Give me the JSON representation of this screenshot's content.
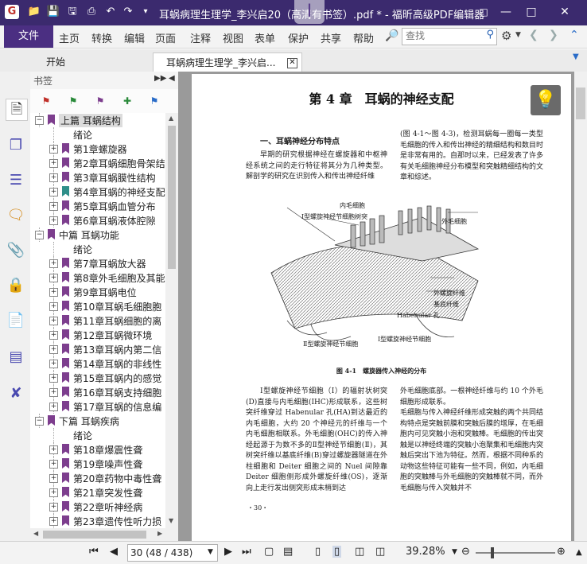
{
  "window": {
    "title": "耳蜗病理生理学_李兴启20（高清有书签）.pdf * - 福昕高级PDF编辑器"
  },
  "menu": {
    "file": "文件",
    "items": [
      "主页",
      "转换",
      "编辑",
      "页面",
      "注释",
      "视图",
      "表单",
      "保护",
      "共享",
      "帮助"
    ]
  },
  "search": {
    "placeholder": "查找"
  },
  "tabs": [
    {
      "label": "开始"
    },
    {
      "label": "耳蜗病理生理学_李兴启..."
    }
  ],
  "bookmarks": {
    "header": "书签",
    "items": [
      {
        "label": "上篇 耳蜗结构",
        "level": 0,
        "expander": "−",
        "flag": true
      },
      {
        "label": "绪论",
        "level": 1,
        "expander": "",
        "flag": false
      },
      {
        "label": "第1章螺旋器",
        "level": 1,
        "expander": "+",
        "flag": true
      },
      {
        "label": "第2章耳蜗细胞骨架结",
        "level": 1,
        "expander": "+",
        "flag": true
      },
      {
        "label": "第3章耳蜗膜性结构",
        "level": 1,
        "expander": "+",
        "flag": true
      },
      {
        "label": "第4章耳蜗的神经支配",
        "level": 1,
        "expander": "+",
        "flag": true,
        "active": true
      },
      {
        "label": "第5章耳蜗血管分布",
        "level": 1,
        "expander": "+",
        "flag": true
      },
      {
        "label": "第6章耳蜗液体腔隙",
        "level": 1,
        "expander": "+",
        "flag": true
      },
      {
        "label": "中篇 耳蜗功能",
        "level": 0,
        "expander": "−",
        "flag": true
      },
      {
        "label": "绪论",
        "level": 1,
        "expander": "",
        "flag": false
      },
      {
        "label": "第7章耳蜗放大器",
        "level": 1,
        "expander": "+",
        "flag": true
      },
      {
        "label": "第8章外毛细胞及其能",
        "level": 1,
        "expander": "+",
        "flag": true
      },
      {
        "label": "第9章耳蜗电位",
        "level": 1,
        "expander": "+",
        "flag": true
      },
      {
        "label": "第10章耳蜗毛细胞胞",
        "level": 1,
        "expander": "+",
        "flag": true
      },
      {
        "label": "第11章耳蜗细胞的离",
        "level": 1,
        "expander": "+",
        "flag": true
      },
      {
        "label": "第12章耳蜗微环境",
        "level": 1,
        "expander": "+",
        "flag": true
      },
      {
        "label": "第13章耳蜗内第二信",
        "level": 1,
        "expander": "+",
        "flag": true
      },
      {
        "label": "第14章耳蜗的非线性",
        "level": 1,
        "expander": "+",
        "flag": true
      },
      {
        "label": "第15章耳蜗内的感觉",
        "level": 1,
        "expander": "+",
        "flag": true
      },
      {
        "label": "第16章耳蜗支持细胞",
        "level": 1,
        "expander": "+",
        "flag": true
      },
      {
        "label": "第17章耳蜗的信息编",
        "level": 1,
        "expander": "+",
        "flag": true
      },
      {
        "label": "下篇 耳蜗疾病",
        "level": 0,
        "expander": "−",
        "flag": true
      },
      {
        "label": "绪论",
        "level": 1,
        "expander": "",
        "flag": false
      },
      {
        "label": "第18章爆震性聋",
        "level": 1,
        "expander": "+",
        "flag": true
      },
      {
        "label": "第19章噪声性聋",
        "level": 1,
        "expander": "+",
        "flag": true
      },
      {
        "label": "第20章药物中毒性聋",
        "level": 1,
        "expander": "+",
        "flag": true
      },
      {
        "label": "第21章突发性聋",
        "level": 1,
        "expander": "+",
        "flag": true
      },
      {
        "label": "第22章听神经病",
        "level": 1,
        "expander": "+",
        "flag": true
      },
      {
        "label": "第23章遗传性听力损",
        "level": 1,
        "expander": "+",
        "flag": true
      }
    ]
  },
  "page": {
    "chapter_title": "第 4 章　耳蜗的神经支配",
    "section_title": "一、耳蜗神经分布特点",
    "para_left_1": "早期的研究根据神经在螺旋器和中枢神经系统之间的走行特征将其分为几种类型。解剖学的研究在识别传入和传出神经纤维",
    "para_right_1": "(图 4-1～图 4-3)，检测耳蜗每一圈每一类型毛细胞的传入和传出神经的精细结构和数目时是非常有用的。自那时以来，已经发表了许多有关毛细胞神经分布模型和突触精细结构的文章和综述。",
    "figure_labels": {
      "inner_hair": "内毛细胞",
      "type1": "Ⅰ型螺旋神经节细胞树突",
      "outer_hair": "外毛细胞",
      "spiral_bundle": "外螺旋纤维",
      "basilar": "基底纤维",
      "habenular": "Habenular 孔",
      "type2_left": "Ⅱ型螺旋神经节细胞",
      "type1_bottom": "Ⅰ型螺旋神经节细胞"
    },
    "figure_caption": "图 4-1　螺旋器传入神经的分布",
    "para_left_2": "Ⅰ型螺旋神经节细胞（Ⅰ）的辐射状树突(D)直接与内毛细胞(IHC)形成联系，这些树突纤维穿过 Habenular 孔(HA)到达最近的内毛细胞，大约 20 个神经元的纤维与一个内毛细胞相联系。外毛细胞(OHC)的传入神经起源于为数不多的Ⅱ型神经节细胞(Ⅱ)，其树突纤维以基底纤维(B)穿过螺旋器隧道在外柱细胞和 Deiter 细胞之间的 Nuel 间隙靠 Deiter 细胞侧形成外螺旋纤维(OS)，逐渐向上走行发出侧突形成末梢到达",
    "para_right_2": "外毛细胞底部。一根神经纤维与约 10 个外毛细胞形成联系。\n毛细胞与传入神经纤维形成突触的两个共同结构特点是突触前膜和突触后膜的增厚，在毛细胞内可见突触小泡和突触棒。毛细胞的传出突触是以神经终端的突触小泡聚集和毛细胞内突触后突出下池为特征。然而，根据不同种系的动物这些特征可能有一些不同，例如，内毛细胞的突触棒与外毛细胞的突触棒就不同，而外毛细胞与传入突触并不",
    "page_number": "・30・"
  },
  "status": {
    "page_field": "30 (48 / 438)",
    "zoom": "39.28%"
  },
  "colors": {
    "titlebar": "#3b2a6e",
    "accent": "#4b2f82",
    "bookmark_flag": "#7d3e8e",
    "active_flag": "#2f8f8a"
  }
}
